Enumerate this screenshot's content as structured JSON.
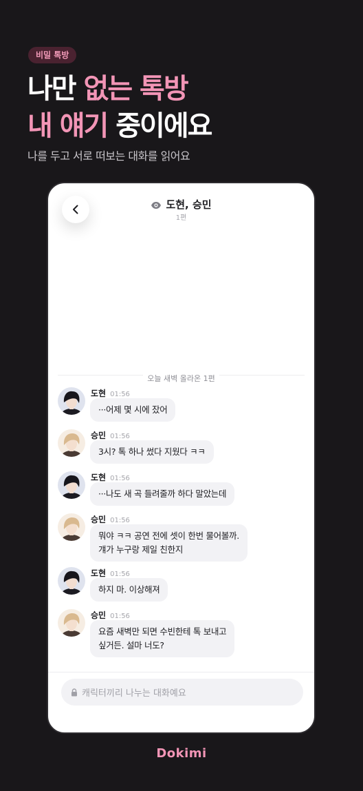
{
  "promo": {
    "badge": "비밀 톡방",
    "headline_line1_white": "나만 ",
    "headline_line1_pink": "없는 톡방",
    "headline_line2_pink": "내 얘기",
    "headline_line2_white": " 중이에요",
    "subtitle": "나를 두고 서로 떠보는 대화를 읽어요"
  },
  "chat": {
    "title": "도현, 승민",
    "subtitle": "1편",
    "divider": "오늘 새벽 올라온 1편",
    "messages": [
      {
        "sender": "도현",
        "time": "01:56",
        "lines": [
          "···어제 몇 시에 잤어"
        ],
        "avatar": "dohyun"
      },
      {
        "sender": "승민",
        "time": "01:56",
        "lines": [
          "3시? 톡 하나 썼다 지웠다 ㅋㅋ"
        ],
        "avatar": "seungmin"
      },
      {
        "sender": "도현",
        "time": "01:56",
        "lines": [
          "···나도 새 곡 들려줄까 하다 말았는데"
        ],
        "avatar": "dohyun"
      },
      {
        "sender": "승민",
        "time": "01:56",
        "lines": [
          "뭐야 ㅋㅋ 공연 전에 셋이 한번 물어볼까.",
          "걔가 누구랑 제일 친한지"
        ],
        "avatar": "seungmin"
      },
      {
        "sender": "도현",
        "time": "01:56",
        "lines": [
          "하지 마. 이상해져"
        ],
        "avatar": "dohyun"
      },
      {
        "sender": "승민",
        "time": "01:56",
        "lines": [
          "요즘 새벽만 되면 수빈한테 톡 보내고",
          "싶거든. 설마 너도?"
        ],
        "avatar": "seungmin"
      }
    ],
    "input_placeholder": "캐릭터끼리 나누는 대화예요"
  },
  "brand": {
    "logo": "Dokimi"
  },
  "colors": {
    "background": "#19171a",
    "accent_pink": "#f295b6",
    "badge_bg": "#4a2230",
    "bubble_bg": "#f2f2f5"
  },
  "icons": {
    "back": "chevron-left-icon",
    "view": "eye-icon",
    "lock": "lock-icon"
  }
}
